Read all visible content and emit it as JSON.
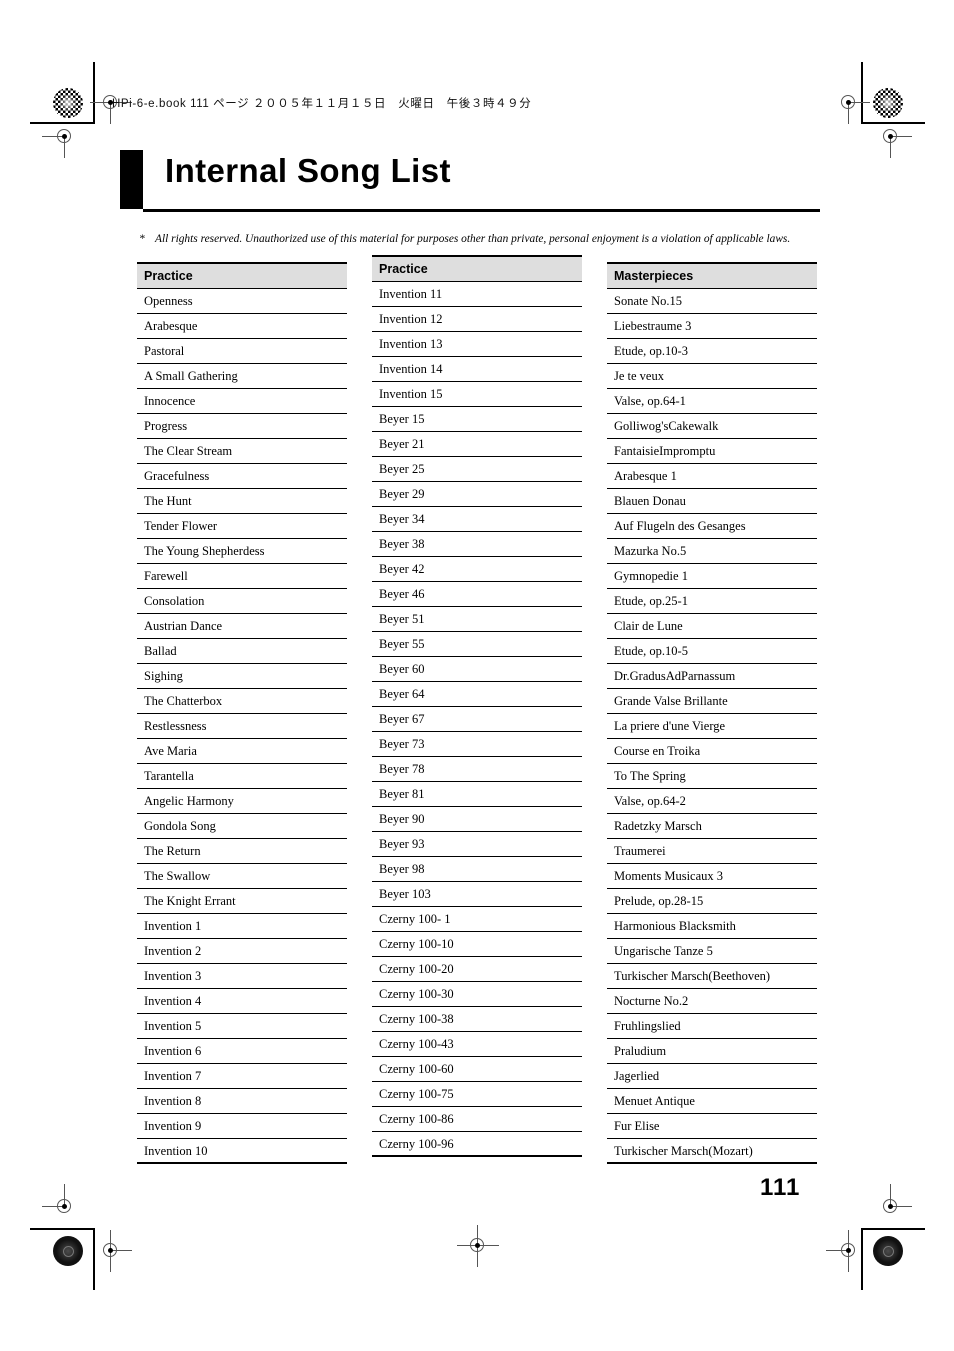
{
  "file_header": "HPi-6-e.book  111 ページ  ２００５年１１月１５日　火曜日　午後３時４９分",
  "title": "Internal Song List",
  "footnote": {
    "marker": "*",
    "text": "All rights reserved. Unauthorized use of this material for purposes other than private, personal enjoyment is a violation of applicable laws."
  },
  "page_number": "111",
  "columns": [
    {
      "header": "Practice",
      "songs": [
        "Openness",
        "Arabesque",
        "Pastoral",
        "A Small Gathering",
        "Innocence",
        "Progress",
        "The Clear Stream",
        "Gracefulness",
        "The Hunt",
        "Tender Flower",
        "The Young Shepherdess",
        "Farewell",
        "Consolation",
        "Austrian Dance",
        "Ballad",
        "Sighing",
        "The Chatterbox",
        "Restlessness",
        "Ave Maria",
        "Tarantella",
        "Angelic Harmony",
        "Gondola Song",
        "The Return",
        "The Swallow",
        "The Knight Errant",
        "Invention 1",
        "Invention 2",
        "Invention 3",
        "Invention 4",
        "Invention 5",
        "Invention 6",
        "Invention 7",
        "Invention 8",
        "Invention 9",
        "Invention 10"
      ]
    },
    {
      "header": "Practice",
      "songs": [
        "Invention 11",
        "Invention 12",
        "Invention 13",
        "Invention 14",
        "Invention 15",
        "Beyer 15",
        "Beyer 21",
        "Beyer 25",
        "Beyer 29",
        "Beyer 34",
        "Beyer 38",
        "Beyer 42",
        "Beyer 46",
        "Beyer 51",
        "Beyer 55",
        "Beyer 60",
        "Beyer 64",
        "Beyer 67",
        "Beyer 73",
        "Beyer 78",
        "Beyer 81",
        "Beyer 90",
        "Beyer 93",
        "Beyer 98",
        "Beyer 103",
        "Czerny 100- 1",
        "Czerny 100-10",
        "Czerny 100-20",
        "Czerny 100-30",
        "Czerny 100-38",
        "Czerny 100-43",
        "Czerny 100-60",
        "Czerny 100-75",
        "Czerny 100-86",
        "Czerny 100-96"
      ]
    },
    {
      "header": "Masterpieces",
      "songs": [
        "Sonate No.15",
        "Liebestraume 3",
        "Etude, op.10-3",
        "Je te veux",
        "Valse, op.64-1",
        "Golliwog'sCakewalk",
        "FantaisieImpromptu",
        "Arabesque 1",
        "Blauen Donau",
        "Auf Flugeln des Gesanges",
        "Mazurka No.5",
        "Gymnopedie 1",
        "Etude, op.25-1",
        "Clair de Lune",
        "Etude, op.10-5",
        "Dr.GradusAdParnassum",
        "Grande Valse Brillante",
        "La priere d'une Vierge",
        "Course en Troika",
        "To The Spring",
        "Valse, op.64-2",
        "Radetzky Marsch",
        "Traumerei",
        "Moments Musicaux 3",
        "Prelude, op.28-15",
        "Harmonious Blacksmith",
        "Ungarische Tanze 5",
        "Turkischer Marsch(Beethoven)",
        "Nocturne No.2",
        "Fruhlingslied",
        "Praludium",
        "Jagerlied",
        "Menuet Antique",
        "Fur Elise",
        "Turkischer Marsch(Mozart)"
      ]
    }
  ]
}
